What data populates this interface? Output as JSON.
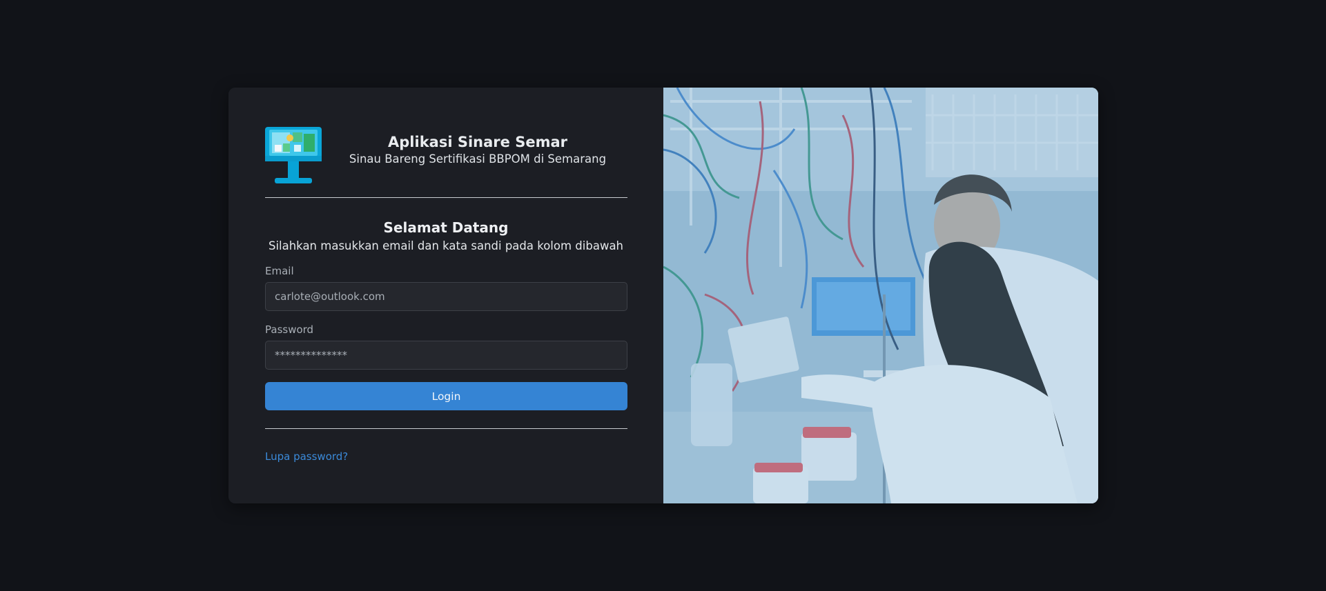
{
  "app": {
    "title": "Aplikasi Sinare Semar",
    "subtitle": "Sinau Bareng Sertifikasi BBPOM di Semarang",
    "logo_icon": "kiosk-icon"
  },
  "login": {
    "heading": "Selamat Datang",
    "instructions": "Silahkan masukkan email dan kata sandi pada kolom dibawah",
    "email_label": "Email",
    "email_placeholder": "carlote@outlook.com",
    "password_label": "Password",
    "password_placeholder": "**************",
    "submit_label": "Login",
    "forgot_label": "Lupa password?"
  },
  "colors": {
    "page_background": "#111318",
    "card_background": "#1c1e24",
    "accent": "#3584d4",
    "link": "#3b8ad9",
    "image_tint": "#8fb6cf"
  },
  "hero": {
    "image_icon": "laboratory-scientists-image"
  }
}
